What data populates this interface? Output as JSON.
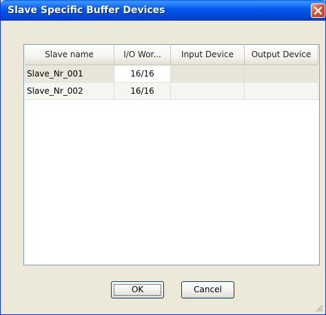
{
  "window": {
    "title": "Slave Specific Buffer Devices"
  },
  "grid": {
    "columns": [
      "Slave name",
      "I/O Wor...",
      "Input Device",
      "Output Device"
    ],
    "rows": [
      {
        "slave_name": "Slave_Nr_001",
        "io_words": "16/16",
        "input_device": "",
        "output_device": ""
      },
      {
        "slave_name": "Slave_Nr_002",
        "io_words": "16/16",
        "input_device": "",
        "output_device": ""
      }
    ]
  },
  "buttons": {
    "ok_label": "OK",
    "cancel_label": "Cancel"
  },
  "icons": {
    "close": "close-icon",
    "resize": "resize-grip-icon"
  },
  "colors": {
    "title_bar": "#0058EE",
    "close_button": "#E1512C",
    "dialog_background": "#ECE9D8",
    "grid_border": "#7F9DB9",
    "row_highlight": "#E8E6DA"
  }
}
